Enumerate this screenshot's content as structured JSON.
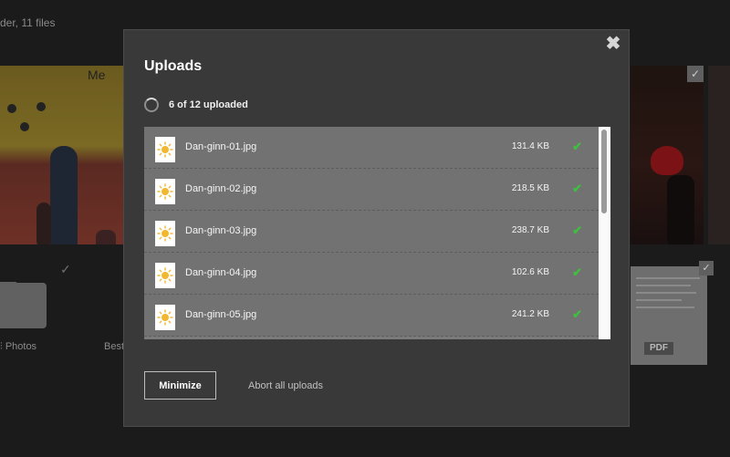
{
  "background": {
    "header_text": "der, 11 files",
    "folder_labels": [
      "Photos",
      "Best"
    ],
    "thumb_sign_text": "Me",
    "doc_badge": "PDF",
    "check_glyph": "✓"
  },
  "modal": {
    "title": "Uploads",
    "close_glyph": "✖",
    "status_text": "6 of 12 uploaded",
    "files": [
      {
        "name": "Dan-ginn-01.jpg",
        "size": "131.4 KB",
        "icon": "sun-image-icon",
        "status": "done"
      },
      {
        "name": "Dan-ginn-02.jpg",
        "size": "218.5 KB",
        "icon": "sun-image-icon",
        "status": "done"
      },
      {
        "name": "Dan-ginn-03.jpg",
        "size": "238.7 KB",
        "icon": "sun-image-icon",
        "status": "done"
      },
      {
        "name": "Dan-ginn-04.jpg",
        "size": "102.6 KB",
        "icon": "sun-image-icon",
        "status": "done"
      },
      {
        "name": "Dan-ginn-05.jpg",
        "size": "241.2 KB",
        "icon": "sun-image-icon",
        "status": "done"
      }
    ],
    "check_glyph": "✔",
    "minimize_label": "Minimize",
    "abort_label": "Abort all uploads"
  },
  "colors": {
    "overlay_bg": "#1b1b1b",
    "modal_bg": "#393939",
    "row_bg": "#727272",
    "success": "#3fbf3f",
    "sun_icon": "#f2b72e"
  }
}
